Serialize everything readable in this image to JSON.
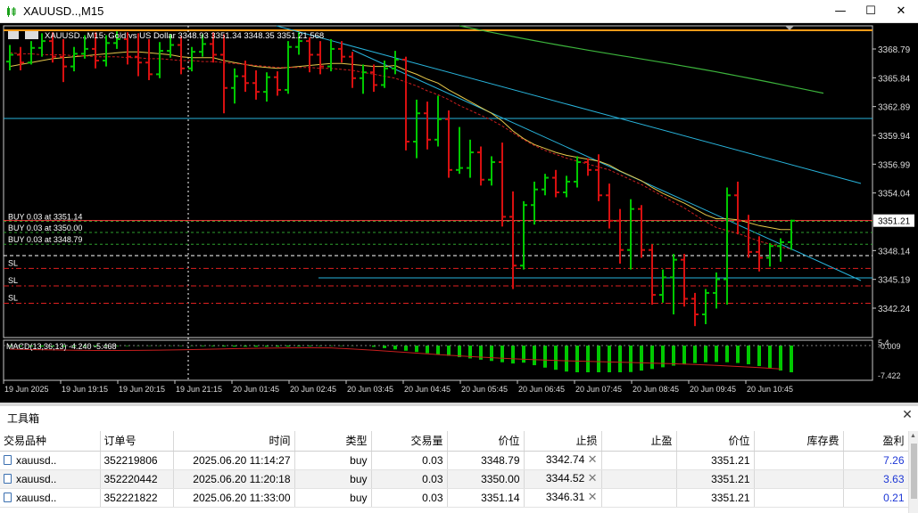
{
  "window": {
    "title": "XAUUSD..,M15",
    "minimize_glyph": "—",
    "maximize_glyph": "☐",
    "close_glyph": "✕"
  },
  "chart": {
    "header_symbol": "XAUUSD..,M15:",
    "header_desc": "Gold vs US Dollar",
    "header_ohlc": "3348.93 3351.34 3348.35 3351.21",
    "header_extra": "568",
    "colors": {
      "background": "#000000",
      "bull": "#00c800",
      "bear": "#d81010",
      "ma_fast": "#e6c84a",
      "ma_slow": "#c81e1e",
      "ma_long": "#3cb43c",
      "trendline": "#28b4dc",
      "order_line": "#2ea02e",
      "sl_line": "#e02020",
      "bid_line": "#ff3b3b",
      "orange_line": "#ff9b1a",
      "macd_hist": "#00c800",
      "macd_signal": "#c81e1e"
    },
    "price_scale": [
      "3368.79",
      "3365.84",
      "3362.89",
      "3359.94",
      "3356.99",
      "3354.04",
      "3351.21",
      "3348.14",
      "3345.19",
      "3342.24"
    ],
    "price_scale_values": [
      3368.79,
      3365.84,
      3362.89,
      3359.94,
      3356.99,
      3354.04,
      3351.21,
      3348.14,
      3345.19,
      3342.24
    ],
    "current_price": "3351.21",
    "order_labels": [
      "BUY 0.03 at 3351.14",
      "BUY 0.03 at 3350.00",
      "BUY 0.03 at 3348.79"
    ],
    "order_prices": [
      3351.14,
      3350.0,
      3348.79
    ],
    "sl_labels": [
      "SL",
      "SL",
      "SL"
    ],
    "sl_prices": [
      3346.31,
      3344.52,
      3342.74
    ],
    "macd_label": "MACD(13,36,13) -4.240 -5.468",
    "macd_scale": [
      "-0.009",
      "-7.422"
    ],
    "macd_top_label": "5.4",
    "time_labels": [
      "19 Jun 2025",
      "19 Jun 19:15",
      "19 Jun 20:15",
      "19 Jun 21:15",
      "20 Jun 01:45",
      "20 Jun 02:45",
      "20 Jun 03:45",
      "20 Jun 04:45",
      "20 Jun 05:45",
      "20 Jun 06:45",
      "20 Jun 07:45",
      "20 Jun 08:45",
      "20 Jun 09:45",
      "20 Jun 10:45"
    ],
    "candles": [
      [
        3367.5,
        3369.2,
        3366.6,
        3368.2
      ],
      [
        3368.2,
        3369.0,
        3366.6,
        3367.4
      ],
      [
        3367.4,
        3369.6,
        3367.2,
        3368.9
      ],
      [
        3368.9,
        3370.4,
        3368.0,
        3369.6
      ],
      [
        3369.6,
        3370.5,
        3367.4,
        3368.0
      ],
      [
        3368.0,
        3369.8,
        3365.4,
        3367.0
      ],
      [
        3367.0,
        3369.0,
        3366.5,
        3368.3
      ],
      [
        3368.3,
        3370.2,
        3367.8,
        3368.8
      ],
      [
        3368.8,
        3370.5,
        3366.8,
        3367.6
      ],
      [
        3367.6,
        3370.2,
        3367.0,
        3369.4
      ],
      [
        3369.4,
        3370.6,
        3368.8,
        3369.8
      ],
      [
        3369.8,
        3370.5,
        3367.2,
        3368.0
      ],
      [
        3368.0,
        3370.4,
        3366.0,
        3367.4
      ],
      [
        3367.4,
        3369.8,
        3365.6,
        3366.2
      ],
      [
        3366.2,
        3369.5,
        3365.8,
        3368.6
      ],
      [
        3368.6,
        3370.3,
        3367.9,
        3369.2
      ],
      [
        3369.2,
        3370.1,
        3366.2,
        3366.8
      ],
      [
        3366.8,
        3369.0,
        3366.5,
        3368.5
      ],
      [
        3368.5,
        3370.3,
        3368.0,
        3369.3
      ],
      [
        3369.3,
        3370.5,
        3367.4,
        3368.2
      ],
      [
        3368.2,
        3370.3,
        3362.2,
        3364.8
      ],
      [
        3364.8,
        3366.8,
        3363.2,
        3366.0
      ],
      [
        3366.0,
        3367.6,
        3364.4,
        3365.3
      ],
      [
        3365.3,
        3366.6,
        3363.6,
        3364.4
      ],
      [
        3364.4,
        3366.4,
        3363.4,
        3365.9
      ],
      [
        3365.9,
        3366.5,
        3364.0,
        3364.6
      ],
      [
        3364.6,
        3369.6,
        3364.2,
        3369.0
      ],
      [
        3369.0,
        3370.5,
        3368.2,
        3369.6
      ],
      [
        3369.6,
        3370.0,
        3366.4,
        3368.2
      ],
      [
        3368.2,
        3369.6,
        3366.2,
        3367.0
      ],
      [
        3367.0,
        3369.8,
        3366.5,
        3368.8
      ],
      [
        3368.8,
        3369.6,
        3367.4,
        3368.0
      ],
      [
        3368.0,
        3368.5,
        3364.8,
        3365.8
      ],
      [
        3365.8,
        3367.2,
        3364.2,
        3366.4
      ],
      [
        3366.4,
        3367.2,
        3364.4,
        3365.1
      ],
      [
        3365.1,
        3367.6,
        3364.8,
        3366.8
      ],
      [
        3366.8,
        3368.6,
        3366.2,
        3367.7
      ],
      [
        3367.7,
        3368.0,
        3358.4,
        3359.3
      ],
      [
        3359.3,
        3363.6,
        3357.6,
        3362.2
      ],
      [
        3362.2,
        3363.4,
        3358.5,
        3359.5
      ],
      [
        3359.5,
        3364.0,
        3358.8,
        3361.6
      ],
      [
        3361.6,
        3362.5,
        3355.6,
        3356.4
      ],
      [
        3356.4,
        3360.8,
        3356.0,
        3356.6
      ],
      [
        3356.6,
        3359.5,
        3355.6,
        3358.2
      ],
      [
        3358.2,
        3358.8,
        3354.8,
        3355.4
      ],
      [
        3355.4,
        3357.8,
        3354.8,
        3357.2
      ],
      [
        3357.2,
        3359.2,
        3350.6,
        3351.6
      ],
      [
        3351.6,
        3354.2,
        3344.2,
        3346.6
      ],
      [
        3346.6,
        3353.2,
        3346.2,
        3352.8
      ],
      [
        3352.8,
        3355.2,
        3350.8,
        3354.4
      ],
      [
        3354.4,
        3356.0,
        3353.8,
        3355.6
      ],
      [
        3355.6,
        3356.4,
        3353.6,
        3354.1
      ],
      [
        3354.1,
        3355.8,
        3353.6,
        3355.2
      ],
      [
        3355.2,
        3357.8,
        3354.6,
        3357.2
      ],
      [
        3357.2,
        3357.6,
        3355.8,
        3356.4
      ],
      [
        3356.4,
        3358.0,
        3353.2,
        3353.8
      ],
      [
        3353.8,
        3355.0,
        3350.4,
        3351.2
      ],
      [
        3351.2,
        3352.4,
        3346.8,
        3348.2
      ],
      [
        3348.2,
        3353.4,
        3346.2,
        3352.4
      ],
      [
        3352.4,
        3352.8,
        3347.4,
        3348.2
      ],
      [
        3348.2,
        3348.8,
        3342.6,
        3343.6
      ],
      [
        3343.6,
        3346.2,
        3342.8,
        3345.4
      ],
      [
        3345.4,
        3347.8,
        3341.6,
        3347.2
      ],
      [
        3347.2,
        3347.8,
        3342.4,
        3343.2
      ],
      [
        3343.2,
        3343.8,
        3340.4,
        3341.6
      ],
      [
        3341.6,
        3344.2,
        3340.6,
        3343.8
      ],
      [
        3343.8,
        3345.9,
        3342.2,
        3345.2
      ],
      [
        3345.2,
        3354.6,
        3342.6,
        3353.8
      ],
      [
        3353.8,
        3355.2,
        3349.8,
        3351.2
      ],
      [
        3351.2,
        3351.8,
        3347.4,
        3348.0
      ],
      [
        3348.0,
        3349.6,
        3346.0,
        3347.4
      ],
      [
        3347.4,
        3348.9,
        3346.5,
        3348.6
      ],
      [
        3348.6,
        3349.4,
        3347.0,
        3349.0
      ],
      [
        3349.0,
        3351.3,
        3348.2,
        3351.2
      ]
    ],
    "ma_fast": [
      3367.0,
      3367.2,
      3367.4,
      3367.6,
      3367.8,
      3367.9,
      3368.0,
      3368.1,
      3368.2,
      3368.3,
      3368.4,
      3368.5,
      3368.5,
      3368.4,
      3368.3,
      3368.2,
      3368.0,
      3367.9,
      3367.9,
      3367.9,
      3367.6,
      3367.4,
      3367.2,
      3367.0,
      3366.9,
      3366.8,
      3366.9,
      3367.0,
      3367.1,
      3367.2,
      3367.3,
      3367.3,
      3367.2,
      3367.1,
      3367.0,
      3367.0,
      3367.1,
      3366.6,
      3366.2,
      3365.7,
      3365.3,
      3364.6,
      3364.0,
      3363.4,
      3362.8,
      3362.2,
      3361.4,
      3360.4,
      3359.6,
      3359.0,
      3358.6,
      3358.2,
      3357.9,
      3357.7,
      3357.5,
      3357.3,
      3356.9,
      3356.3,
      3355.8,
      3355.3,
      3354.6,
      3354.0,
      3353.5,
      3353.0,
      3352.4,
      3351.8,
      3351.4,
      3351.4,
      3351.3,
      3351.0,
      3350.7,
      3350.5,
      3350.3,
      3350.3
    ],
    "ma_slow": [
      3368.4,
      3368.3,
      3368.3,
      3368.2,
      3368.2,
      3368.2,
      3368.1,
      3368.1,
      3368.0,
      3368.0,
      3368.0,
      3367.9,
      3367.9,
      3367.8,
      3367.8,
      3367.7,
      3367.6,
      3367.6,
      3367.5,
      3367.5,
      3367.4,
      3367.3,
      3367.2,
      3367.1,
      3367.0,
      3366.9,
      3366.9,
      3366.9,
      3366.9,
      3366.8,
      3366.8,
      3366.7,
      3366.6,
      3366.4,
      3366.2,
      3366.0,
      3365.8,
      3365.4,
      3365.0,
      3364.5,
      3364.1,
      3363.6,
      3363.0,
      3362.5,
      3362.0,
      3361.5,
      3360.9,
      3360.2,
      3359.5,
      3358.9,
      3358.4,
      3358.0,
      3357.6,
      3357.3,
      3357.0,
      3356.7,
      3356.4,
      3355.9,
      3355.4,
      3354.9,
      3354.3,
      3353.7,
      3353.1,
      3352.5,
      3351.8,
      3351.1,
      3350.5,
      3350.2,
      3349.9,
      3349.5,
      3349.1,
      3348.8,
      3348.5,
      3348.3
    ]
  },
  "toolbox": {
    "title": "工具箱",
    "close_glyph": "✕",
    "columns": [
      "交易品种",
      "订单号",
      "时间",
      "类型",
      "交易量",
      "价位",
      "止损",
      "止盈",
      "价位",
      "库存费",
      "盈利"
    ],
    "rows": [
      {
        "symbol": "xauusd..",
        "order": "352219806",
        "time": "2025.06.20 11:14:27",
        "type": "buy",
        "volume": "0.03",
        "price": "3348.79",
        "sl": "3342.74",
        "tp": "",
        "current": "3351.21",
        "swap": "",
        "profit": "7.26"
      },
      {
        "symbol": "xauusd..",
        "order": "352220442",
        "time": "2025.06.20 11:20:18",
        "type": "buy",
        "volume": "0.03",
        "price": "3350.00",
        "sl": "3344.52",
        "tp": "",
        "current": "3351.21",
        "swap": "",
        "profit": "3.63"
      },
      {
        "symbol": "xauusd..",
        "order": "352221822",
        "time": "2025.06.20 11:33:00",
        "type": "buy",
        "volume": "0.03",
        "price": "3351.14",
        "sl": "3346.31",
        "tp": "",
        "current": "3351.21",
        "swap": "",
        "profit": "0.21"
      }
    ]
  }
}
